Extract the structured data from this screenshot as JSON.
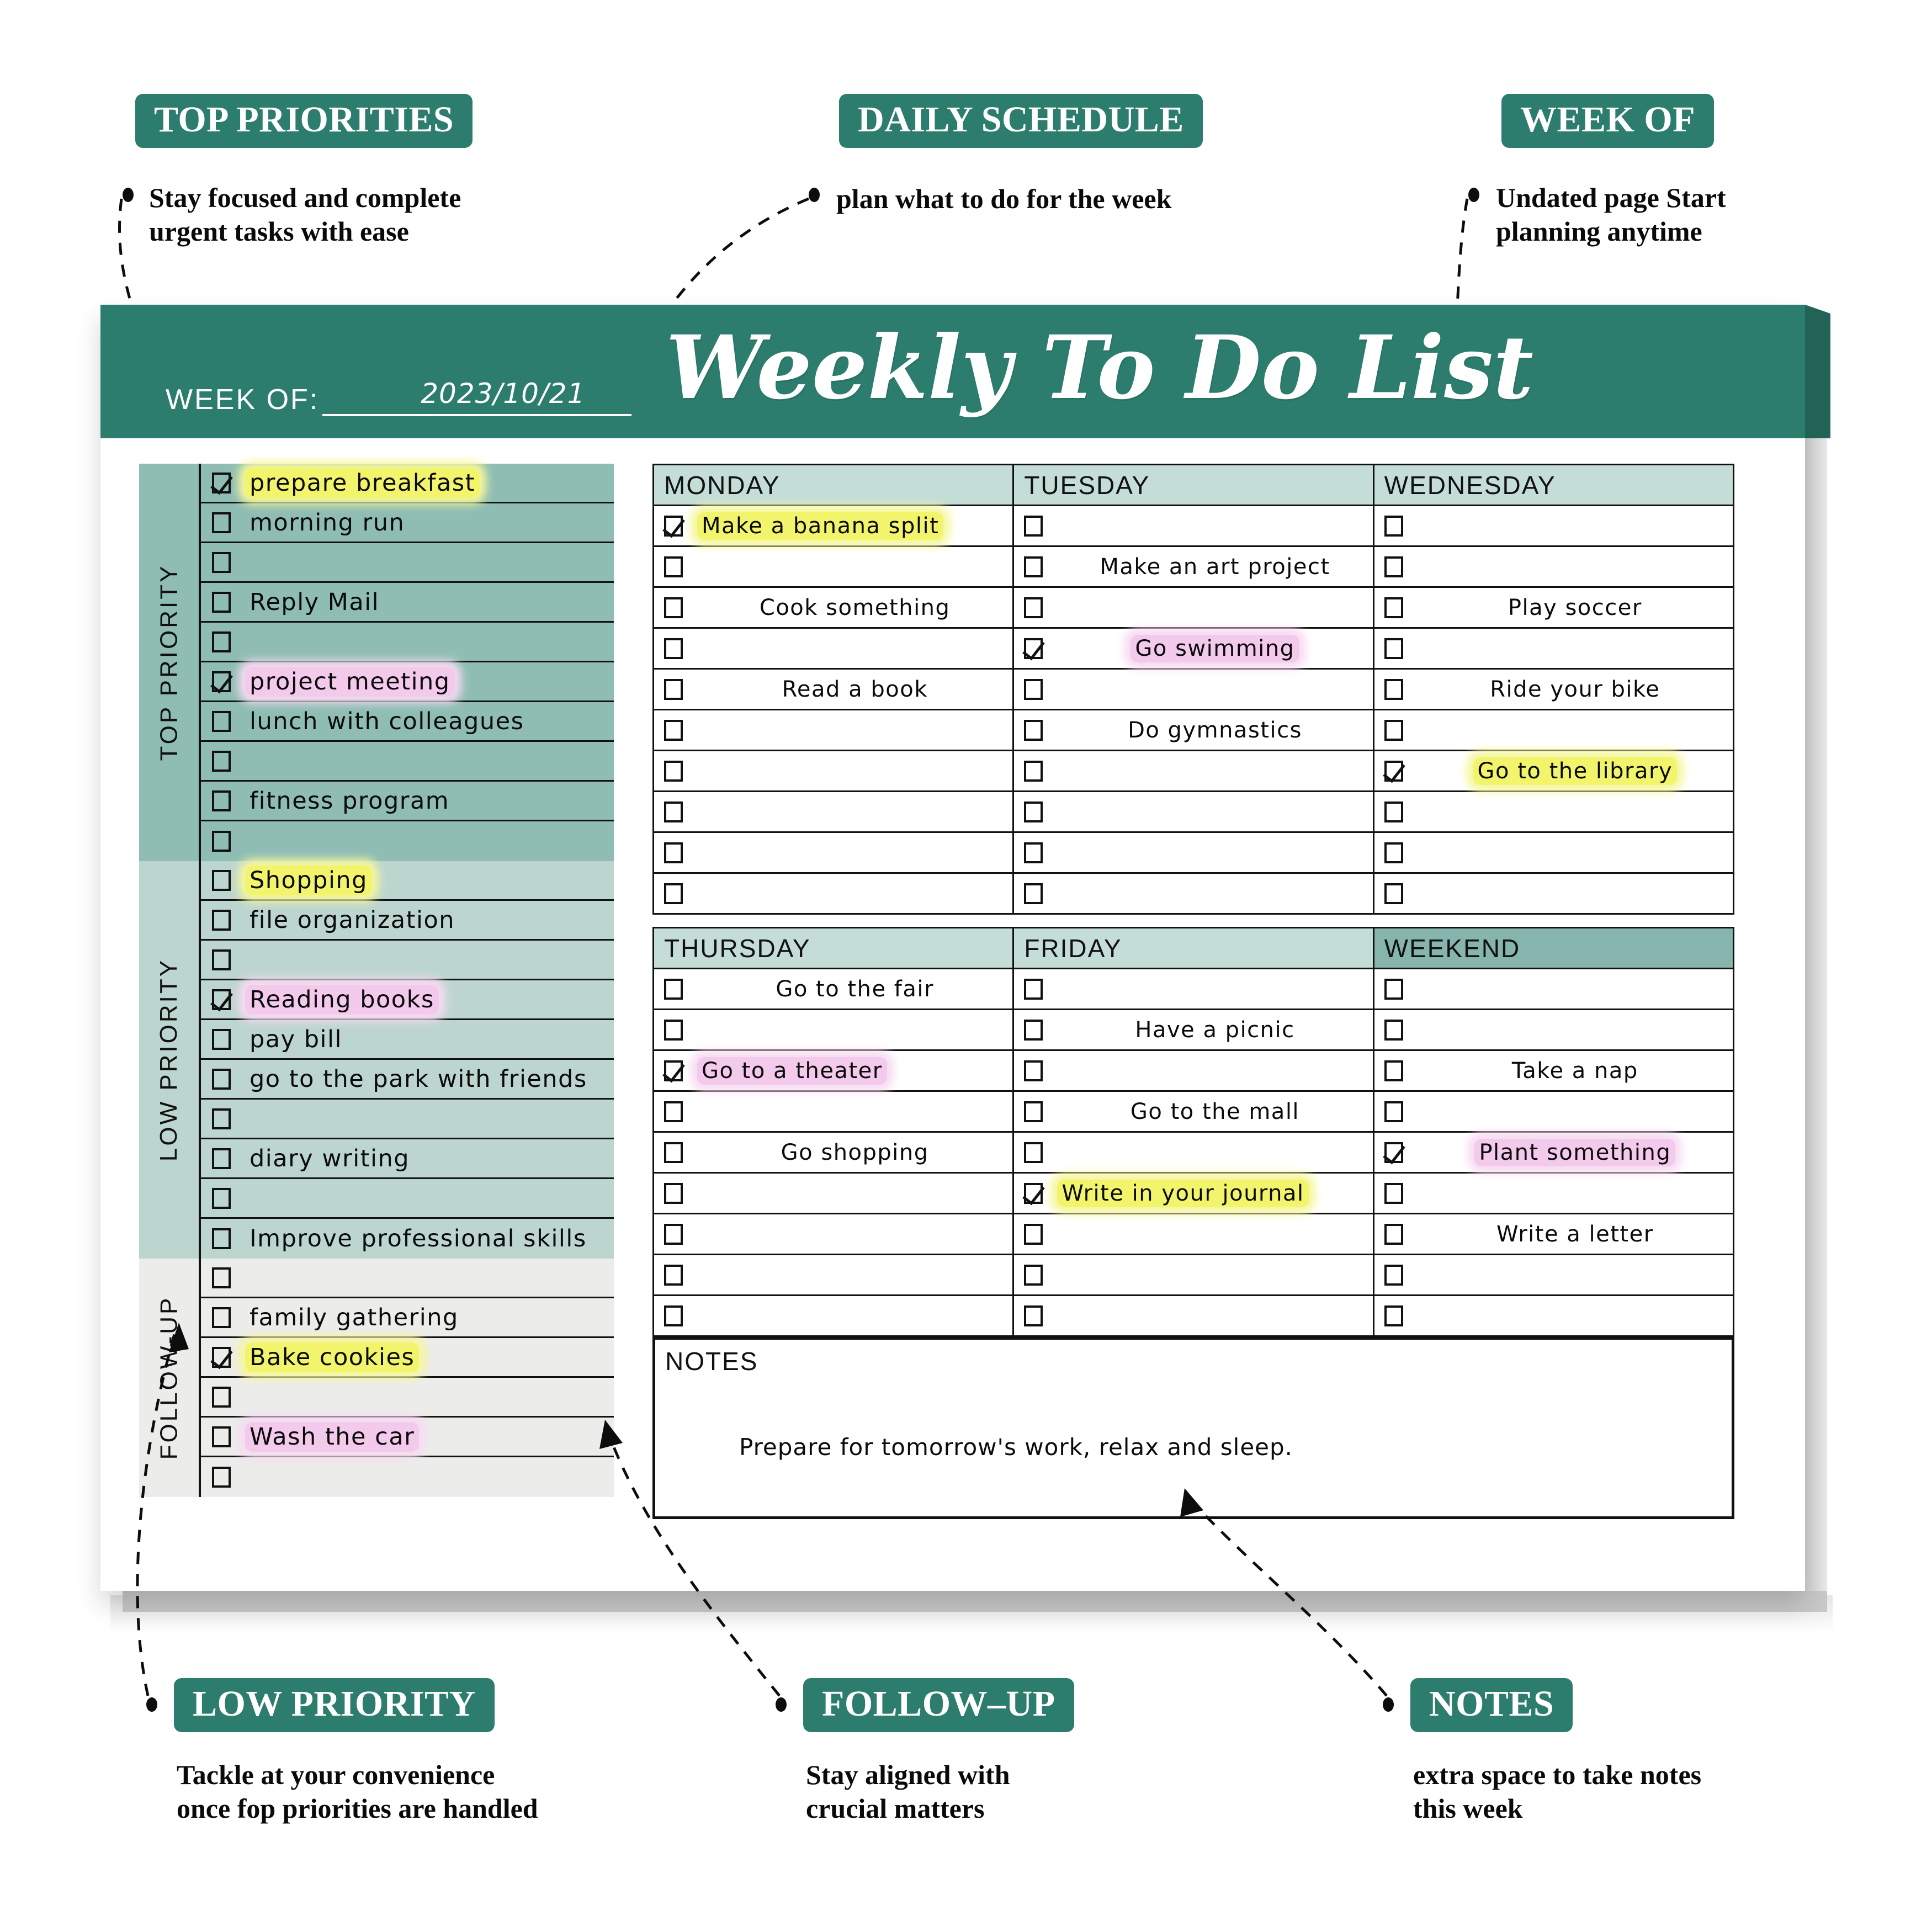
{
  "callouts": {
    "top_left": {
      "chip": "TOP PRIORITIES",
      "desc": "Stay focused and complete\nurgent tasks with ease"
    },
    "top_mid": {
      "chip": "DAILY SCHEDULE",
      "desc": "plan what to do for the week"
    },
    "top_right": {
      "chip": "WEEK OF",
      "desc": "Undated page Start\nplanning anytime"
    },
    "bot_left": {
      "chip": "LOW PRIORITY",
      "desc": "Tackle at your convenience\nonce fop priorities are handled"
    },
    "bot_mid": {
      "chip": "FOLLOW–UP",
      "desc": "Stay aligned with\ncrucial matters"
    },
    "bot_right": {
      "chip": "NOTES",
      "desc": "extra space to take notes\nthis week"
    }
  },
  "header": {
    "title": "Weekly To Do List",
    "week_of_label": "WEEK OF:",
    "week_of_value": "2023/10/21"
  },
  "priority_sections": [
    {
      "spine_label": "TOP PRIORITY",
      "bg": "#8fbdb4",
      "rows": [
        {
          "text": "prepare breakfast",
          "checked": true,
          "highlight": "yellow"
        },
        {
          "text": "morning run",
          "checked": false,
          "highlight": "none"
        },
        {
          "text": "",
          "checked": false,
          "highlight": "none"
        },
        {
          "text": "Reply Mail",
          "checked": false,
          "highlight": "none"
        },
        {
          "text": "",
          "checked": false,
          "highlight": "none"
        },
        {
          "text": "project meeting",
          "checked": true,
          "highlight": "pink"
        },
        {
          "text": "lunch with colleagues",
          "checked": false,
          "highlight": "none"
        },
        {
          "text": "",
          "checked": false,
          "highlight": "none"
        },
        {
          "text": "fitness program",
          "checked": false,
          "highlight": "none"
        },
        {
          "text": "",
          "checked": false,
          "highlight": "none"
        }
      ]
    },
    {
      "spine_label": "LOW PRIORITY",
      "bg": "#bdd5cf",
      "rows": [
        {
          "text": "Shopping",
          "checked": false,
          "highlight": "yellow"
        },
        {
          "text": "file organization",
          "checked": false,
          "highlight": "none"
        },
        {
          "text": "",
          "checked": false,
          "highlight": "none"
        },
        {
          "text": "Reading books",
          "checked": true,
          "highlight": "pink"
        },
        {
          "text": "pay bill",
          "checked": false,
          "highlight": "none"
        },
        {
          "text": "go to the park with friends",
          "checked": false,
          "highlight": "none"
        },
        {
          "text": "",
          "checked": false,
          "highlight": "none"
        },
        {
          "text": "diary writing",
          "checked": false,
          "highlight": "none"
        },
        {
          "text": "",
          "checked": false,
          "highlight": "none"
        },
        {
          "text": "Improve professional skills",
          "checked": false,
          "highlight": "none"
        }
      ]
    },
    {
      "spine_label": "FOLLOW-UP",
      "bg": "#ececeb",
      "rows": [
        {
          "text": "",
          "checked": false,
          "highlight": "none"
        },
        {
          "text": "family gathering",
          "checked": false,
          "highlight": "none"
        },
        {
          "text": "Bake cookies",
          "checked": true,
          "highlight": "yellow"
        },
        {
          "text": "",
          "checked": false,
          "highlight": "none"
        },
        {
          "text": "Wash the car",
          "checked": false,
          "highlight": "pink"
        },
        {
          "text": "",
          "checked": false,
          "highlight": "none"
        }
      ]
    }
  ],
  "schedule": {
    "block1": [
      {
        "day": "MONDAY",
        "weekend": false,
        "rows": [
          {
            "text": "Make a banana split",
            "checked": true,
            "highlight": "yellow",
            "align": "left"
          },
          {
            "text": "",
            "checked": false,
            "highlight": "none",
            "align": "center"
          },
          {
            "text": "Cook something",
            "checked": false,
            "highlight": "none",
            "align": "center"
          },
          {
            "text": "",
            "checked": false,
            "highlight": "none",
            "align": "center"
          },
          {
            "text": "Read a book",
            "checked": false,
            "highlight": "none",
            "align": "center"
          },
          {
            "text": "",
            "checked": false,
            "highlight": "none",
            "align": "center"
          },
          {
            "text": "",
            "checked": false,
            "highlight": "none",
            "align": "center"
          },
          {
            "text": "",
            "checked": false,
            "highlight": "none",
            "align": "center"
          },
          {
            "text": "",
            "checked": false,
            "highlight": "none",
            "align": "center"
          },
          {
            "text": "",
            "checked": false,
            "highlight": "none",
            "align": "center"
          }
        ]
      },
      {
        "day": "TUESDAY",
        "weekend": false,
        "rows": [
          {
            "text": "",
            "checked": false,
            "highlight": "none",
            "align": "center"
          },
          {
            "text": "Make an art project",
            "checked": false,
            "highlight": "none",
            "align": "center"
          },
          {
            "text": "",
            "checked": false,
            "highlight": "none",
            "align": "center"
          },
          {
            "text": "Go swimming",
            "checked": true,
            "highlight": "pink",
            "align": "center"
          },
          {
            "text": "",
            "checked": false,
            "highlight": "none",
            "align": "center"
          },
          {
            "text": "Do gymnastics",
            "checked": false,
            "highlight": "none",
            "align": "center"
          },
          {
            "text": "",
            "checked": false,
            "highlight": "none",
            "align": "center"
          },
          {
            "text": "",
            "checked": false,
            "highlight": "none",
            "align": "center"
          },
          {
            "text": "",
            "checked": false,
            "highlight": "none",
            "align": "center"
          },
          {
            "text": "",
            "checked": false,
            "highlight": "none",
            "align": "center"
          }
        ]
      },
      {
        "day": "WEDNESDAY",
        "weekend": false,
        "rows": [
          {
            "text": "",
            "checked": false,
            "highlight": "none",
            "align": "center"
          },
          {
            "text": "",
            "checked": false,
            "highlight": "none",
            "align": "center"
          },
          {
            "text": "Play soccer",
            "checked": false,
            "highlight": "none",
            "align": "center"
          },
          {
            "text": "",
            "checked": false,
            "highlight": "none",
            "align": "center"
          },
          {
            "text": "Ride your bike",
            "checked": false,
            "highlight": "none",
            "align": "center"
          },
          {
            "text": "",
            "checked": false,
            "highlight": "none",
            "align": "center"
          },
          {
            "text": "Go to the library",
            "checked": true,
            "highlight": "yellow",
            "align": "center"
          },
          {
            "text": "",
            "checked": false,
            "highlight": "none",
            "align": "center"
          },
          {
            "text": "",
            "checked": false,
            "highlight": "none",
            "align": "center"
          },
          {
            "text": "",
            "checked": false,
            "highlight": "none",
            "align": "center"
          }
        ]
      }
    ],
    "block2": [
      {
        "day": "THURSDAY",
        "weekend": false,
        "rows": [
          {
            "text": "Go to the fair",
            "checked": false,
            "highlight": "none",
            "align": "center"
          },
          {
            "text": "",
            "checked": false,
            "highlight": "none",
            "align": "center"
          },
          {
            "text": "Go to a theater",
            "checked": true,
            "highlight": "pink",
            "align": "left"
          },
          {
            "text": "",
            "checked": false,
            "highlight": "none",
            "align": "center"
          },
          {
            "text": "Go shopping",
            "checked": false,
            "highlight": "none",
            "align": "center"
          },
          {
            "text": "",
            "checked": false,
            "highlight": "none",
            "align": "center"
          },
          {
            "text": "",
            "checked": false,
            "highlight": "none",
            "align": "center"
          },
          {
            "text": "",
            "checked": false,
            "highlight": "none",
            "align": "center"
          },
          {
            "text": "",
            "checked": false,
            "highlight": "none",
            "align": "center"
          },
          {
            "text": "",
            "checked": false,
            "highlight": "none",
            "align": "center"
          }
        ]
      },
      {
        "day": "FRIDAY",
        "weekend": false,
        "rows": [
          {
            "text": "",
            "checked": false,
            "highlight": "none",
            "align": "center"
          },
          {
            "text": "Have a picnic",
            "checked": false,
            "highlight": "none",
            "align": "center"
          },
          {
            "text": "",
            "checked": false,
            "highlight": "none",
            "align": "center"
          },
          {
            "text": "Go to the mall",
            "checked": false,
            "highlight": "none",
            "align": "center"
          },
          {
            "text": "",
            "checked": false,
            "highlight": "none",
            "align": "center"
          },
          {
            "text": "Write in your journal",
            "checked": true,
            "highlight": "yellow",
            "align": "left"
          },
          {
            "text": "",
            "checked": false,
            "highlight": "none",
            "align": "center"
          },
          {
            "text": "",
            "checked": false,
            "highlight": "none",
            "align": "center"
          },
          {
            "text": "",
            "checked": false,
            "highlight": "none",
            "align": "center"
          },
          {
            "text": "",
            "checked": false,
            "highlight": "none",
            "align": "center"
          }
        ]
      },
      {
        "day": "WEEKEND",
        "weekend": true,
        "rows": [
          {
            "text": "",
            "checked": false,
            "highlight": "none",
            "align": "center"
          },
          {
            "text": "",
            "checked": false,
            "highlight": "none",
            "align": "center"
          },
          {
            "text": "Take a nap",
            "checked": false,
            "highlight": "none",
            "align": "center"
          },
          {
            "text": "",
            "checked": false,
            "highlight": "none",
            "align": "center"
          },
          {
            "text": "Plant something",
            "checked": true,
            "highlight": "pink",
            "align": "center"
          },
          {
            "text": "",
            "checked": false,
            "highlight": "none",
            "align": "center"
          },
          {
            "text": "Write a letter",
            "checked": false,
            "highlight": "none",
            "align": "center"
          },
          {
            "text": "",
            "checked": false,
            "highlight": "none",
            "align": "center"
          },
          {
            "text": "",
            "checked": false,
            "highlight": "none",
            "align": "center"
          },
          {
            "text": "",
            "checked": false,
            "highlight": "none",
            "align": "center"
          }
        ]
      }
    ]
  },
  "notes": {
    "label": "NOTES",
    "text": "Prepare for tomorrow's work, relax and sleep."
  },
  "colors": {
    "brand_green": "#2d7d6e",
    "top_priority_bg": "#8fbdb4",
    "low_priority_bg": "#bdd5cf",
    "follow_up_bg": "#ececeb",
    "day_header_bg": "#c5ddd7",
    "weekend_header_bg": "#85b5ac",
    "highlight_yellow": "#f2f56b",
    "highlight_pink": "#f3c9ec"
  }
}
